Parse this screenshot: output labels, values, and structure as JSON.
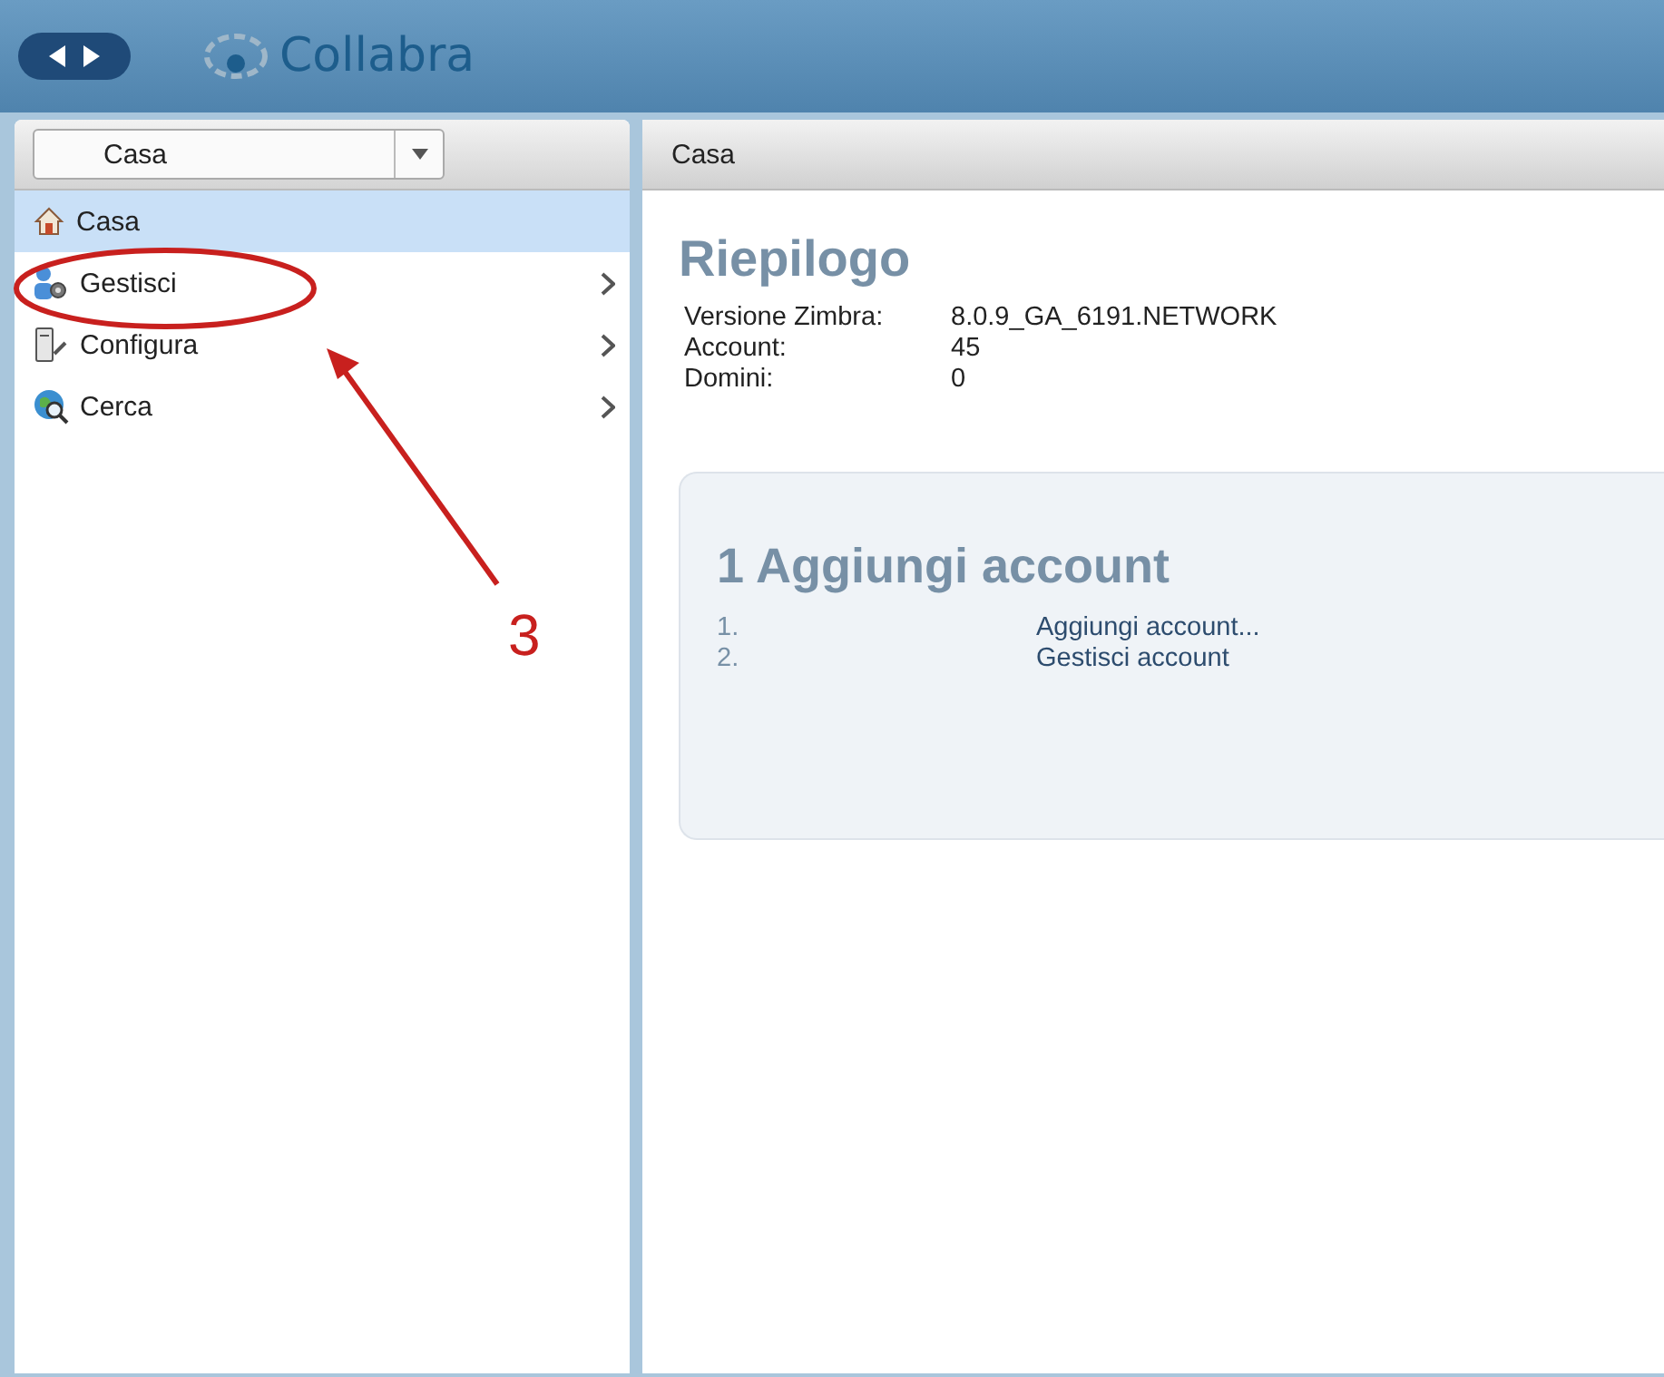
{
  "app": {
    "name": "Collabra"
  },
  "sidebar": {
    "breadcrumb": "Casa",
    "items": [
      {
        "label": "Casa",
        "selected": true,
        "has_children": false
      },
      {
        "label": "Gestisci",
        "selected": false,
        "has_children": true
      },
      {
        "label": "Configura",
        "selected": false,
        "has_children": true
      },
      {
        "label": "Cerca",
        "selected": false,
        "has_children": true
      }
    ]
  },
  "content": {
    "header": "Casa",
    "title": "Riepilogo",
    "summary": [
      {
        "label": "Versione Zimbra:",
        "value": "8.0.9_GA_6191.NETWORK"
      },
      {
        "label": "Account:",
        "value": "45"
      },
      {
        "label": "Domini:",
        "value": "0"
      }
    ],
    "card": {
      "title": "1 Aggiungi account",
      "steps": [
        {
          "number": "1.",
          "link": "Aggiungi account..."
        },
        {
          "number": "2.",
          "link": "Gestisci account"
        }
      ]
    }
  },
  "annotation": {
    "label": "3"
  }
}
